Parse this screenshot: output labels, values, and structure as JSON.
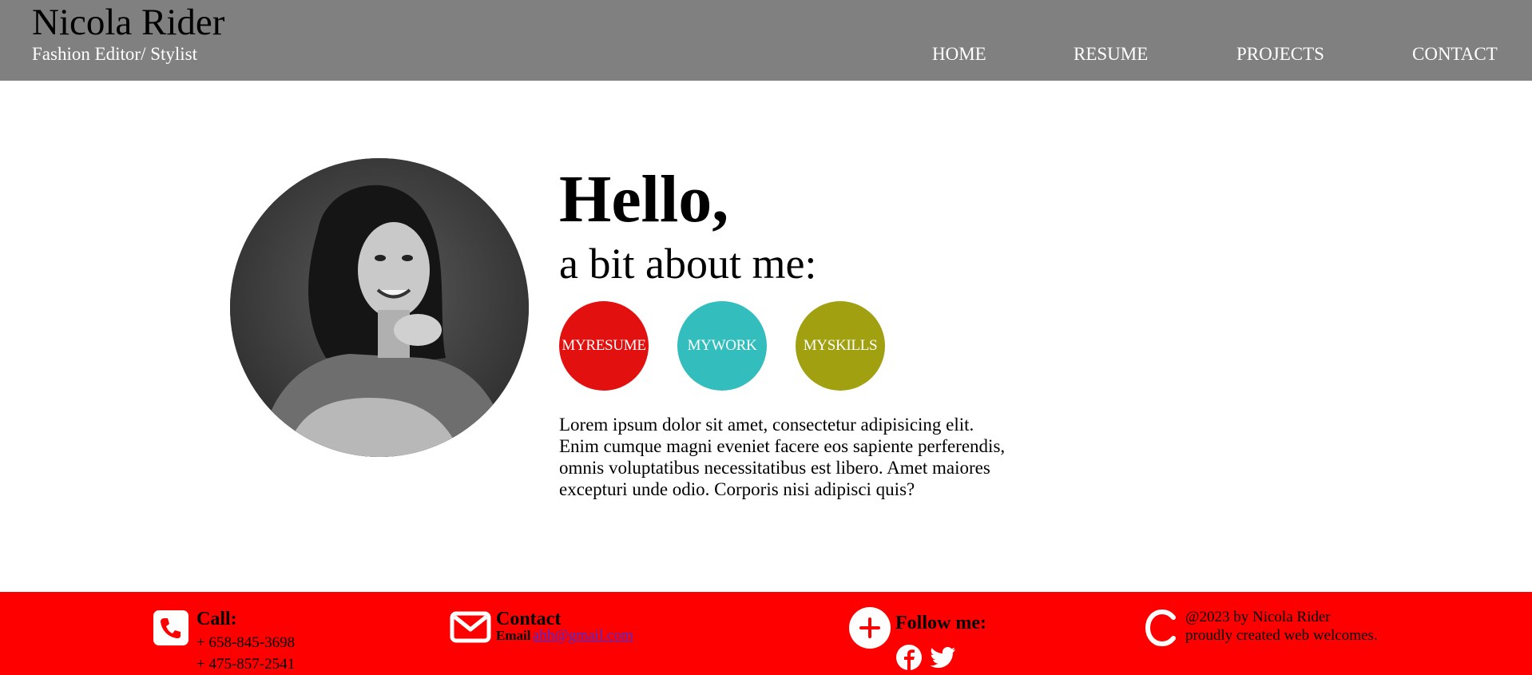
{
  "header": {
    "name": "Nicola Rider",
    "subtitle": "Fashion Editor/ Stylist",
    "nav": [
      "HOME",
      "RESUME",
      "PROJECTS",
      "CONTACT"
    ]
  },
  "hero": {
    "greeting": "Hello,",
    "subheading": "a bit about me:",
    "buttons": [
      {
        "label": "MYRESUME",
        "color": "#e31010"
      },
      {
        "label": "MYWORK",
        "color": "#33bdbd"
      },
      {
        "label": "MYSKILLS",
        "color": "#a0a010"
      }
    ],
    "bio": "Lorem ipsum dolor sit amet, consectetur adipisicing elit. Enim cumque magni eveniet facere eos sapiente perferendis, omnis voluptatibus necessitatibus est libero. Amet maiores excepturi unde odio. Corporis nisi adipisci quis?",
    "portrait_icon": "portrait-photo"
  },
  "footer": {
    "background": "#ff0000",
    "call": {
      "title": "Call:",
      "phones": [
        "+ 658-845-3698",
        "+ 475-857-2541"
      ],
      "icon": "phone-icon"
    },
    "contact": {
      "title": "Contact",
      "email_label": "Email",
      "email": "ahh@gmail.com",
      "icon": "envelope-icon"
    },
    "follow": {
      "title": "Follow me:",
      "icon": "plus-circle-icon",
      "socials": [
        "facebook-icon",
        "twitter-icon"
      ]
    },
    "copyright": {
      "line1": "@2023 by Nicola Rider",
      "line2": "proudly created web welcomes.",
      "icon": "copyright-icon"
    }
  }
}
